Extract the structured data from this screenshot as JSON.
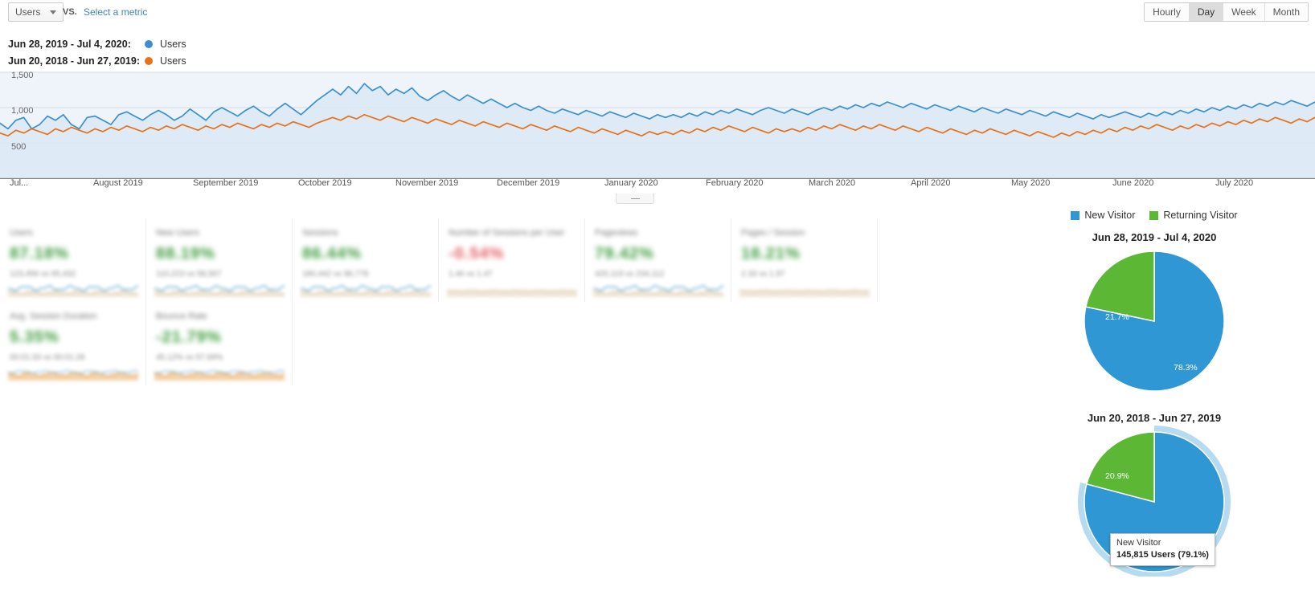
{
  "toolbar": {
    "metric_selected": "Users",
    "vs_label": "VS.",
    "select_metric_link": "Select a metric",
    "granularity": [
      {
        "label": "Hourly",
        "selected": false
      },
      {
        "label": "Day",
        "selected": true
      },
      {
        "label": "Week",
        "selected": false
      },
      {
        "label": "Month",
        "selected": false
      }
    ]
  },
  "legend": [
    {
      "date_range": "Jun 28, 2019 - Jul 4, 2020:",
      "metric": "Users",
      "color": "#3b8fd1"
    },
    {
      "date_range": "Jun 20, 2018 - Jun 27, 2019:",
      "metric": "Users",
      "color": "#e8711a"
    }
  ],
  "colors": {
    "series_primary": "#3b8fd1",
    "series_secondary": "#e8711a",
    "pie_new": "#2e97d4",
    "pie_returning": "#5cb735",
    "link": "#4285b4",
    "positive": "#3c9a3c",
    "negative": "#e05c63"
  },
  "chart_data": {
    "type": "line",
    "title": "",
    "xlabel": "",
    "ylabel": "Users",
    "ylim": [
      0,
      1500
    ],
    "yticks": [
      "500",
      "1,000",
      "1,500"
    ],
    "grid": true,
    "legend_position": "top-left",
    "x_tick_labels": [
      "Jul...",
      "August 2019",
      "September 2019",
      "October 2019",
      "November 2019",
      "December 2019",
      "January 2020",
      "February 2020",
      "March 2020",
      "April 2020",
      "May 2020",
      "June 2020",
      "July 2020"
    ],
    "series": [
      {
        "name": "Users",
        "range": "Jun 28, 2019 - Jul 4, 2020",
        "color": "#3b8fd1",
        "filled": true,
        "values": [
          780,
          700,
          820,
          860,
          700,
          760,
          880,
          820,
          900,
          760,
          700,
          860,
          880,
          820,
          760,
          900,
          940,
          880,
          820,
          900,
          960,
          900,
          820,
          880,
          980,
          900,
          820,
          940,
          1000,
          940,
          880,
          960,
          1020,
          940,
          880,
          980,
          1060,
          980,
          900,
          1000,
          1100,
          1180,
          1260,
          1180,
          1300,
          1200,
          1340,
          1240,
          1300,
          1180,
          1260,
          1200,
          1280,
          1160,
          1100,
          1180,
          1240,
          1160,
          1100,
          1180,
          1120,
          1060,
          1120,
          1060,
          1000,
          1060,
          1000,
          960,
          1020,
          960,
          920,
          980,
          940,
          900,
          960,
          920,
          880,
          940,
          900,
          860,
          920,
          880,
          840,
          900,
          860,
          900,
          860,
          920,
          880,
          940,
          900,
          960,
          920,
          980,
          940,
          900,
          960,
          1000,
          960,
          920,
          980,
          940,
          900,
          960,
          1000,
          960,
          1020,
          980,
          1040,
          1000,
          1060,
          1020,
          1080,
          1040,
          1000,
          1060,
          1020,
          980,
          1040,
          1000,
          960,
          1020,
          980,
          940,
          1000,
          960,
          920,
          980,
          940,
          900,
          960,
          920,
          880,
          940,
          900,
          860,
          920,
          880,
          840,
          900,
          860,
          900,
          940,
          900,
          860,
          920,
          880,
          940,
          900,
          960,
          920,
          980,
          940,
          1000,
          960,
          1020,
          980,
          1040,
          1000,
          1060,
          1020,
          1080,
          1040,
          1100,
          1060,
          1020,
          1080
        ]
      },
      {
        "name": "Users",
        "range": "Jun 20, 2018 - Jun 27, 2019",
        "color": "#e8711a",
        "filled": false,
        "values": [
          640,
          600,
          680,
          640,
          700,
          660,
          620,
          700,
          660,
          720,
          680,
          640,
          700,
          660,
          720,
          680,
          740,
          700,
          660,
          720,
          680,
          740,
          700,
          760,
          720,
          680,
          740,
          700,
          760,
          720,
          780,
          740,
          700,
          760,
          720,
          780,
          740,
          800,
          760,
          720,
          780,
          820,
          860,
          820,
          880,
          840,
          900,
          860,
          820,
          880,
          840,
          800,
          860,
          820,
          780,
          840,
          800,
          760,
          820,
          780,
          740,
          800,
          760,
          720,
          780,
          740,
          700,
          760,
          720,
          680,
          740,
          700,
          660,
          720,
          680,
          640,
          700,
          660,
          620,
          680,
          640,
          600,
          660,
          620,
          660,
          620,
          680,
          640,
          700,
          660,
          720,
          680,
          740,
          700,
          660,
          720,
          680,
          640,
          700,
          660,
          700,
          660,
          720,
          680,
          740,
          700,
          760,
          720,
          680,
          740,
          700,
          760,
          720,
          680,
          740,
          700,
          660,
          720,
          680,
          640,
          700,
          660,
          620,
          680,
          640,
          700,
          660,
          620,
          680,
          640,
          600,
          660,
          620,
          580,
          640,
          600,
          660,
          620,
          680,
          640,
          700,
          660,
          720,
          680,
          740,
          700,
          760,
          720,
          680,
          740,
          700,
          760,
          720,
          780,
          740,
          800,
          760,
          820,
          780,
          840,
          800,
          860,
          820,
          780,
          840,
          800,
          860
        ]
      }
    ]
  },
  "cards": {
    "row1": [
      {
        "title": "Users",
        "value": "87.18%",
        "direction": "up",
        "sub": "123,456 vs 65,432",
        "spark": "mixed"
      },
      {
        "title": "New Users",
        "value": "88.19%",
        "direction": "up",
        "sub": "110,223 vs 58,567",
        "spark": "mixed"
      },
      {
        "title": "Sessions",
        "value": "86.44%",
        "direction": "up",
        "sub": "180,442 vs 96,778",
        "spark": "mixed"
      },
      {
        "title": "Number of Sessions per User",
        "value": "-0.54%",
        "direction": "down",
        "sub": "1.46 vs 1.47",
        "spark": "flat"
      },
      {
        "title": "Pageviews",
        "value": "79.42%",
        "direction": "up",
        "sub": "420,119 vs 234,112",
        "spark": "mixed"
      },
      {
        "title": "Pages / Session",
        "value": "18.21%",
        "direction": "up",
        "sub": "2.33 vs 1.97",
        "spark": "flat"
      }
    ],
    "row2": [
      {
        "title": "Avg. Session Duration",
        "value": "5.35%",
        "direction": "up",
        "sub": "00:01:33 vs 00:01:28",
        "spark": "orange"
      },
      {
        "title": "Bounce Rate",
        "value": "-21.79%",
        "direction": "up",
        "sub": "45.12% vs 57.69%",
        "spark": "orange"
      }
    ]
  },
  "pies": {
    "legend": [
      {
        "label": "New Visitor",
        "color": "#2e97d4"
      },
      {
        "label": "Returning Visitor",
        "color": "#5cb735"
      }
    ],
    "charts": [
      {
        "title": "Jun 28, 2019 - Jul 4, 2020",
        "slices": [
          {
            "name": "New Visitor",
            "percent": 78.3,
            "label": "78.3%",
            "color": "#2e97d4"
          },
          {
            "name": "Returning Visitor",
            "percent": 21.7,
            "label": "21.7%",
            "color": "#5cb735"
          }
        ]
      },
      {
        "title": "Jun 20, 2018 - Jun 27, 2019",
        "slices": [
          {
            "name": "New Visitor",
            "percent": 79.1,
            "label": "79.1%",
            "color": "#2e97d4",
            "highlighted": true
          },
          {
            "name": "Returning Visitor",
            "percent": 20.9,
            "label": "20.9%",
            "color": "#5cb735"
          }
        ],
        "tooltip": {
          "name": "New Visitor",
          "value": "145,815 Users (79.1%)"
        }
      }
    ]
  }
}
